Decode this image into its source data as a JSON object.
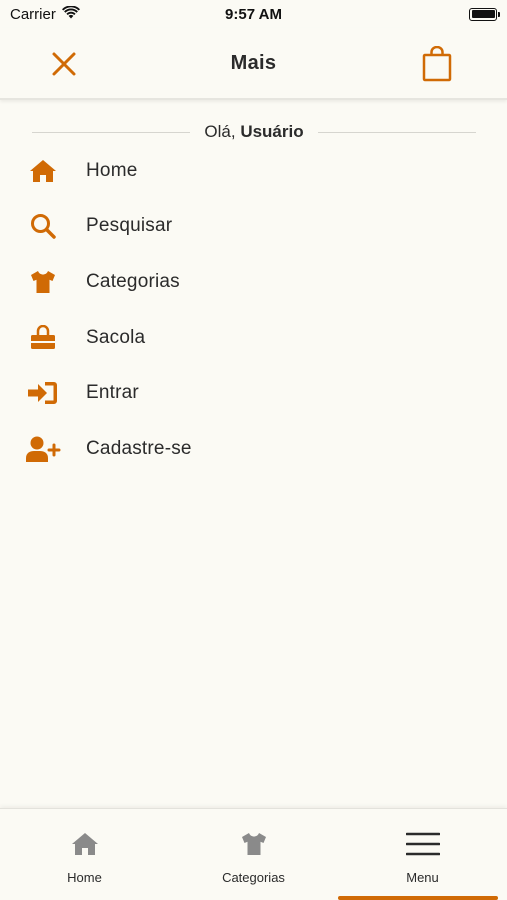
{
  "status_bar": {
    "carrier": "Carrier",
    "time": "9:57 AM"
  },
  "header": {
    "title": "Mais"
  },
  "greeting": {
    "prefix": "Olá,",
    "name": "Usuário"
  },
  "menu": {
    "items": [
      {
        "label": "Home",
        "icon": "home-icon"
      },
      {
        "label": "Pesquisar",
        "icon": "search-icon"
      },
      {
        "label": "Categorias",
        "icon": "shirt-icon"
      },
      {
        "label": "Sacola",
        "icon": "shopping-bag-icon"
      },
      {
        "label": "Entrar",
        "icon": "sign-in-icon"
      },
      {
        "label": "Cadastre-se",
        "icon": "user-plus-icon"
      }
    ]
  },
  "tab_bar": {
    "tabs": [
      {
        "label": "Home",
        "icon": "home-icon",
        "active": false
      },
      {
        "label": "Categorias",
        "icon": "shirt-icon",
        "active": false
      },
      {
        "label": "Menu",
        "icon": "hamburger-icon",
        "active": true
      }
    ]
  },
  "colors": {
    "accent": "#d06a05",
    "background": "#fbfaf4",
    "text": "#2b2b2b",
    "inactive_icon": "#8a8a8a"
  }
}
